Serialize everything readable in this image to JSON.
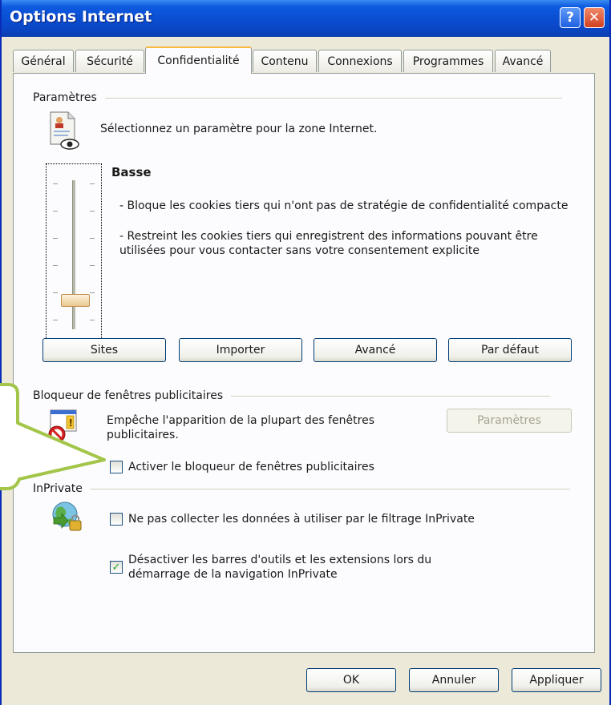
{
  "window": {
    "title": "Options Internet",
    "help_glyph": "?",
    "close_glyph": "✕"
  },
  "tabs": [
    {
      "label": "Général"
    },
    {
      "label": "Sécurité"
    },
    {
      "label": "Confidentialité",
      "active": true
    },
    {
      "label": "Contenu"
    },
    {
      "label": "Connexions"
    },
    {
      "label": "Programmes"
    },
    {
      "label": "Avancé"
    }
  ],
  "parametres": {
    "heading": "Paramètres",
    "instruction": "Sélectionnez un paramètre pour la zone Internet.",
    "level": "Basse",
    "description_1": "- Bloque les cookies tiers qui n'ont pas de stratégie de confidentialité compacte",
    "description_2": "- Restreint les cookies tiers qui enregistrent des informations pouvant être utilisées pour vous contacter sans votre consentement explicite",
    "slider_level_fraction": 0.2,
    "buttons": {
      "sites": "Sites",
      "importer": "Importer",
      "avance": "Avancé",
      "par_defaut": "Par défaut"
    }
  },
  "popup_blocker": {
    "heading": "Bloqueur de fenêtres publicitaires",
    "description": "Empêche l'apparition de la plupart des fenêtres publicitaires.",
    "settings_button": "Paramètres",
    "checkbox_label": "Activer le bloqueur de fenêtres publicitaires",
    "checked": false
  },
  "inprivate": {
    "heading": "InPrivate",
    "option_1_label": "Ne pas collecter les données à utiliser par le filtrage InPrivate",
    "option_1_checked": false,
    "option_2_label": "Désactiver les barres d'outils et les extensions lors du démarrage de la navigation InPrivate",
    "option_2_checked": true
  },
  "footer": {
    "ok": "OK",
    "annuler": "Annuler",
    "appliquer": "Appliquer"
  },
  "colors": {
    "titlebar": "#0a4dd0",
    "callout_green": "#a3c64a",
    "active_tab_accent": "#f7b843"
  }
}
